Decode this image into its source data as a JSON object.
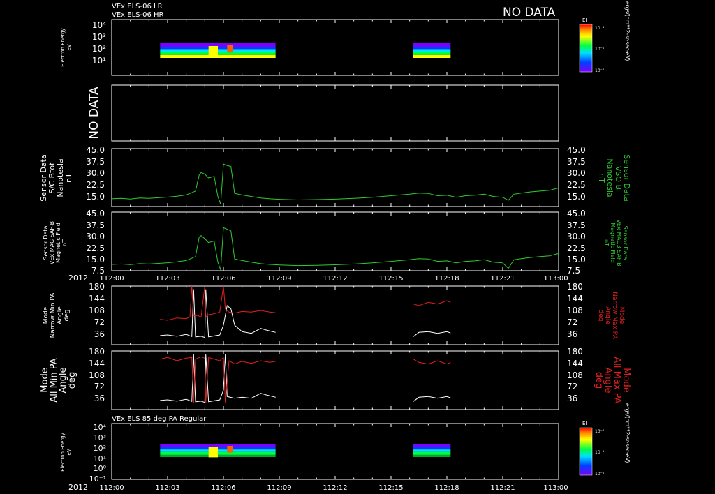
{
  "header": {
    "line1": "VEx ELS-06 LR",
    "line2": "VEx ELS-06 HR",
    "no_data": "NO DATA",
    "year_label": "2012"
  },
  "colorbar": {
    "title": "EI",
    "unit": "ergs/(cm**2-sr-sec-eV)",
    "ticks": [
      "10⁻⁴",
      "10⁻⁶",
      "10⁻⁸"
    ]
  },
  "x_axis": {
    "ticks": [
      "112:00",
      "112:03",
      "112:06",
      "112:09",
      "112:12",
      "112:15",
      "112:18",
      "112:21",
      "113:00"
    ]
  },
  "panels": {
    "p1": {
      "ylabel": [
        "Electron Energy",
        "eV"
      ],
      "yticks": [
        "10⁴",
        "10³",
        "10²",
        "10¹"
      ]
    },
    "p2": {
      "side_label": "NO DATA"
    },
    "p3": {
      "ylabel_left": [
        "Sensor Data",
        "S/C Btot",
        "Nanotesla",
        "nT"
      ],
      "ylabel_right": [
        "Sensor Data",
        "VSO B",
        "Nanotesla",
        "nT"
      ],
      "yticks": [
        "45.0",
        "37.5",
        "30.0",
        "22.5",
        "15.0"
      ]
    },
    "p4": {
      "ylabel_left": [
        "Sensor Data",
        "VEx MAG SAF-B",
        "Magnetic Field",
        "nT"
      ],
      "ylabel_right": [
        "Sensor Data",
        "VEx MAG3 SAF-B",
        "Magnetic Field",
        "nT"
      ],
      "yticks": [
        "45.0",
        "37.5",
        "30.0",
        "22.5",
        "15.0",
        "7.5"
      ]
    },
    "p5": {
      "ylabel_left": [
        "Mode",
        "Narrow Min PA",
        "Angle",
        "deg"
      ],
      "ylabel_right": [
        "Mode",
        "Narrow Max PA",
        "Angle",
        "deg"
      ],
      "yticks": [
        "180",
        "144",
        "108",
        "72",
        "36"
      ]
    },
    "p6": {
      "ylabel_left": [
        "Mode",
        "All Min PA",
        "Angle",
        "deg"
      ],
      "ylabel_right": [
        "Mode",
        "All Max PA",
        "Angle",
        "deg"
      ],
      "yticks": [
        "180",
        "144",
        "108",
        "72",
        "36"
      ]
    },
    "p7": {
      "title": "VEx ELS 85 deg PA Regular",
      "ylabel": [
        "Electron Energy",
        "eV"
      ],
      "yticks": [
        "10⁴",
        "10³",
        "10²",
        "10¹",
        "10⁰",
        "10⁻¹"
      ]
    }
  },
  "colors": {
    "green": "#2ecc2e",
    "red": "#e02020",
    "white": "#ffffff"
  },
  "chart_data": [
    {
      "type": "heatmap",
      "title": "VEx ELS-06 LR / VEx ELS-06 HR",
      "ylabel": "Electron Energy eV",
      "xlim": [
        "112:00",
        "113:00"
      ],
      "ylog": true,
      "data_intervals": [
        [
          "112:02.6",
          "112:08.8"
        ],
        [
          "112:16.2",
          "112:18.2"
        ]
      ]
    },
    {
      "type": "line",
      "ylabel": "Sensor Data S/C Btot Nanotesla nT",
      "ylim": [
        7.5,
        45.0
      ],
      "series": [
        {
          "color": "#2ecc2e",
          "x": [
            0,
            0.5,
            1,
            1.5,
            2,
            2.5,
            3,
            3.5,
            4,
            4.2,
            4.5,
            4.7,
            4.8,
            5.0,
            5.2,
            5.5,
            5.7,
            5.85,
            6.0,
            6.2,
            6.4,
            6.6,
            7,
            7.5,
            8,
            8.5,
            9,
            10,
            11,
            12,
            13,
            14,
            15,
            16,
            16.5,
            17,
            17.5,
            18,
            18.5,
            19,
            19.5,
            20,
            20.5,
            21,
            21.3,
            21.6,
            22,
            22.5,
            23,
            23.5,
            24
          ],
          "y": [
            12.5,
            12.8,
            12.4,
            13.0,
            12.8,
            13.2,
            13.6,
            14.2,
            15.0,
            16.0,
            17.5,
            28,
            29.5,
            28.5,
            26,
            27,
            14,
            9,
            35,
            34,
            33.5,
            16,
            15.0,
            14.0,
            13.0,
            12.5,
            12.2,
            11.8,
            12.0,
            12.3,
            12.8,
            13.5,
            14.5,
            15.5,
            16.2,
            16.0,
            14.5,
            14.8,
            13.5,
            14.5,
            14.8,
            15.5,
            14.0,
            13.5,
            11.5,
            15.5,
            16.2,
            17.0,
            17.5,
            18.0,
            19.5
          ]
        }
      ]
    },
    {
      "type": "line",
      "ylabel": "Sensor Data VEx MAG SAF-B Magnetic Field nT",
      "ylim": [
        7.5,
        45.0
      ],
      "series": [
        {
          "color": "#2ecc2e",
          "x": [
            0,
            0.5,
            1,
            1.5,
            2,
            2.5,
            3,
            3.5,
            4,
            4.2,
            4.5,
            4.7,
            4.8,
            5.0,
            5.2,
            5.5,
            5.7,
            5.85,
            6.0,
            6.2,
            6.4,
            6.6,
            7,
            7.5,
            8,
            8.5,
            9,
            10,
            11,
            12,
            13,
            14,
            15,
            16,
            16.5,
            17,
            17.5,
            18,
            18.5,
            19,
            19.5,
            20,
            20.5,
            21,
            21.3,
            21.6,
            22,
            22.5,
            23,
            23.5,
            24
          ],
          "y": [
            11.5,
            11.8,
            11.4,
            12.0,
            11.8,
            12.2,
            12.6,
            13.2,
            14.0,
            15.0,
            16.5,
            29,
            30,
            28,
            25.5,
            26.5,
            13,
            8,
            35,
            34,
            33,
            15,
            14.0,
            13.0,
            12.0,
            11.5,
            11.2,
            10.8,
            11.0,
            11.3,
            11.8,
            12.5,
            13.5,
            14.5,
            15.2,
            15.0,
            13.5,
            13.8,
            12.5,
            13.5,
            13.8,
            14.5,
            13.0,
            12.5,
            9.0,
            14.5,
            15.2,
            16.0,
            16.5,
            17.0,
            18.5
          ]
        }
      ]
    },
    {
      "type": "line",
      "ylabel": "Mode Narrow Min PA / Narrow Max PA Angle deg",
      "ylim": [
        0,
        180
      ],
      "series": [
        {
          "color": "#ffffff",
          "x": [
            2.6,
            3,
            3.5,
            4,
            4.3,
            4.4,
            4.5,
            4.8,
            5.0,
            5.05,
            5.2,
            5.5,
            5.8,
            6.0,
            6.1,
            6.2,
            6.4,
            6.6,
            7,
            7.5,
            8,
            8.3,
            8.5,
            8.8
          ],
          "y": [
            28,
            30,
            26,
            32,
            25,
            170,
            24,
            26,
            22,
            170,
            24,
            27,
            30,
            60,
            90,
            120,
            110,
            60,
            40,
            35,
            50,
            45,
            42,
            38
          ]
        },
        {
          "color": "#ffffff",
          "x": [
            16.2,
            16.5,
            17,
            17.5,
            18,
            18.2
          ],
          "y": [
            25,
            38,
            40,
            35,
            40,
            36
          ]
        },
        {
          "color": "#e02020",
          "x": [
            2.6,
            3,
            3.5,
            4,
            4.2,
            4.3,
            4.4,
            4.6,
            4.8,
            5.0,
            5.05,
            5.2,
            5.5,
            5.8,
            6.0,
            6.1,
            6.3,
            6.6,
            7,
            7.5,
            8,
            8.5,
            8.8
          ],
          "y": [
            78,
            75,
            82,
            80,
            85,
            180,
            88,
            90,
            85,
            180,
            86,
            92,
            95,
            100,
            180,
            110,
            100,
            97,
            102,
            100,
            105,
            100,
            98
          ]
        },
        {
          "color": "#e02020",
          "x": [
            16.2,
            16.5,
            17,
            17.5,
            18,
            18.2
          ],
          "y": [
            125,
            120,
            130,
            125,
            135,
            130
          ]
        }
      ]
    },
    {
      "type": "line",
      "ylabel": "Mode All Min PA / All Max PA Angle deg",
      "ylim": [
        0,
        180
      ],
      "series": [
        {
          "color": "#ffffff",
          "x": [
            2.6,
            3,
            3.5,
            4,
            4.3,
            4.4,
            4.5,
            4.8,
            5.0,
            5.05,
            5.2,
            5.5,
            5.8,
            6.0,
            6.1,
            6.2,
            6.6,
            7,
            7.5,
            8,
            8.3,
            8.8
          ],
          "y": [
            28,
            30,
            26,
            32,
            25,
            170,
            24,
            26,
            22,
            170,
            24,
            27,
            30,
            60,
            170,
            40,
            35,
            38,
            35,
            50,
            45,
            38
          ]
        },
        {
          "color": "#ffffff",
          "x": [
            16.2,
            16.5,
            17,
            17.5,
            18,
            18.2
          ],
          "y": [
            25,
            38,
            40,
            35,
            40,
            36
          ]
        },
        {
          "color": "#e02020",
          "x": [
            2.6,
            3,
            3.5,
            4,
            4.3,
            4.4,
            4.5,
            4.8,
            5.0,
            5.05,
            5.2,
            5.5,
            5.8,
            6.0,
            6.1,
            6.3,
            6.6,
            7,
            7.5,
            8,
            8.5,
            8.8
          ],
          "y": [
            155,
            160,
            150,
            158,
            160,
            20,
            155,
            162,
            158,
            20,
            160,
            155,
            150,
            160,
            20,
            150,
            140,
            148,
            142,
            150,
            145,
            148
          ]
        },
        {
          "color": "#e02020",
          "x": [
            16.2,
            16.5,
            17,
            17.5,
            18,
            18.2
          ],
          "y": [
            155,
            145,
            140,
            150,
            140,
            145
          ]
        }
      ]
    },
    {
      "type": "heatmap",
      "title": "VEx ELS 85 deg PA Regular",
      "ylabel": "Electron Energy eV",
      "xlim": [
        "112:00",
        "113:00"
      ],
      "ylog": true,
      "data_intervals": [
        [
          "112:02.6",
          "112:08.8"
        ],
        [
          "112:16.2",
          "112:18.2"
        ]
      ]
    }
  ]
}
